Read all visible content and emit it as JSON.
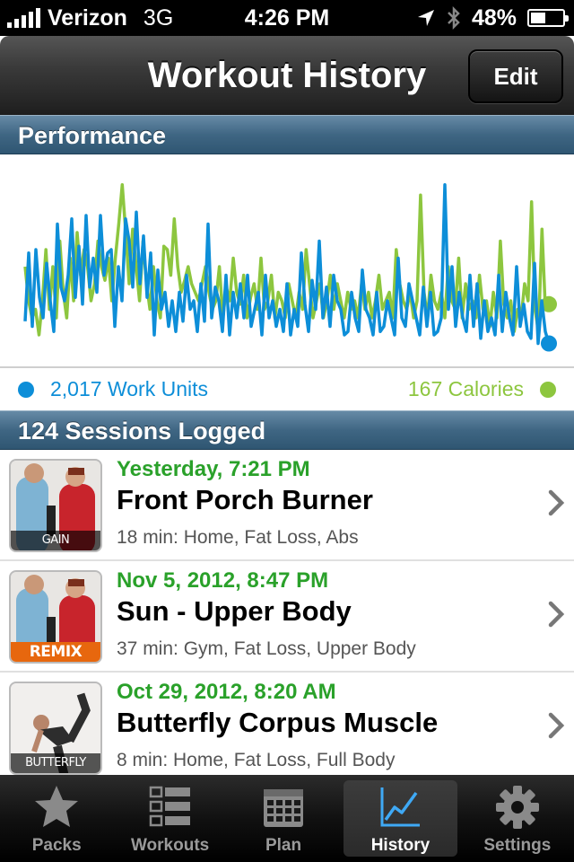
{
  "status_bar": {
    "carrier": "Verizon",
    "network": "3G",
    "time": "4:26 PM",
    "battery": "48%",
    "battery_level": 0.48
  },
  "nav": {
    "title": "Workout History",
    "edit_label": "Edit"
  },
  "performance": {
    "header": "Performance",
    "legend_units": "2,017 Work Units",
    "legend_calories": "167 Calories",
    "colors": {
      "work_units": "#0d8ed8",
      "calories": "#8dc63f"
    }
  },
  "chart_data": {
    "type": "line",
    "series": [
      {
        "name": "Work Units",
        "color": "#0d8ed8",
        "values": [
          0.18,
          0.58,
          0.15,
          0.6,
          0.32,
          0.2,
          0.52,
          0.3,
          0.12,
          0.75,
          0.38,
          0.3,
          0.45,
          0.78,
          0.32,
          0.62,
          0.28,
          0.8,
          0.38,
          0.55,
          0.35,
          0.8,
          0.45,
          0.58,
          0.6,
          0.15,
          0.5,
          0.3,
          0.78,
          0.65,
          0.38,
          0.82,
          0.4,
          0.68,
          0.32,
          0.58,
          0.1,
          0.48,
          0.25,
          0.35,
          0.15,
          0.3,
          0.12,
          0.35,
          0.18,
          0.45,
          0.25,
          0.3,
          0.12,
          0.4,
          0.18,
          0.75,
          0.2,
          0.38,
          0.3,
          0.12,
          0.45,
          0.1,
          0.35,
          0.2,
          0.4,
          0.2,
          0.45,
          0.15,
          0.25,
          0.35,
          0.1,
          0.45,
          0.2,
          0.3,
          0.15,
          0.25,
          0.12,
          0.4,
          0.1,
          0.25,
          0.15,
          0.58,
          0.28,
          0.12,
          0.42,
          0.25,
          0.65,
          0.2,
          0.38,
          0.15,
          0.45,
          0.3,
          0.25,
          0.1,
          0.12,
          0.35,
          0.2,
          0.12,
          0.48,
          0.25,
          0.2,
          0.1,
          0.35,
          0.12,
          0.15,
          0.3,
          0.2,
          0.1,
          0.55,
          0.2,
          0.15,
          0.4,
          0.3,
          0.2,
          0.1,
          0.38,
          0.15,
          0.35,
          0.1,
          0.12,
          0.2,
          0.98,
          0.25,
          0.5,
          0.15,
          0.35,
          0.2,
          0.12,
          0.45,
          0.15,
          0.4,
          0.08,
          0.3,
          0.12,
          0.2,
          0.1,
          0.45,
          0.12,
          0.35,
          0.2,
          0.1,
          0.5,
          0.15,
          0.28,
          0.12,
          0.08,
          0.52,
          0.05,
          0.3,
          0.12,
          0.05
        ],
        "end_value": 0.05
      },
      {
        "name": "Calories",
        "color": "#8dc63f",
        "values": [
          0.5,
          0.3,
          0.2,
          0.25,
          0.1,
          0.3,
          0.6,
          0.25,
          0.5,
          0.2,
          0.65,
          0.35,
          0.2,
          0.55,
          0.3,
          0.7,
          0.45,
          0.6,
          0.5,
          0.3,
          0.4,
          0.65,
          0.5,
          0.42,
          0.55,
          0.3,
          0.55,
          0.75,
          0.98,
          0.7,
          0.4,
          0.72,
          0.5,
          0.3,
          0.65,
          0.4,
          0.25,
          0.5,
          0.3,
          0.2,
          0.62,
          0.6,
          0.45,
          0.78,
          0.5,
          0.35,
          0.42,
          0.5,
          0.4,
          0.35,
          0.3,
          0.4,
          0.5,
          0.35,
          0.25,
          0.3,
          0.5,
          0.2,
          0.38,
          0.3,
          0.55,
          0.35,
          0.28,
          0.45,
          0.2,
          0.32,
          0.4,
          0.25,
          0.55,
          0.25,
          0.3,
          0.45,
          0.2,
          0.35,
          0.3,
          0.2,
          0.4,
          0.3,
          0.2,
          0.35,
          0.25,
          0.6,
          0.4,
          0.2,
          0.3,
          0.4,
          0.2,
          0.3,
          0.45,
          0.25,
          0.4,
          0.3,
          0.2,
          0.35,
          0.25,
          0.3,
          0.2,
          0.4,
          0.25,
          0.35,
          0.2,
          0.3,
          0.45,
          0.25,
          0.3,
          0.35,
          0.2,
          0.6,
          0.4,
          0.3,
          0.25,
          0.35,
          0.2,
          0.3,
          0.92,
          0.35,
          0.2,
          0.45,
          0.3,
          0.25,
          0.35,
          0.2,
          0.5,
          0.3,
          0.25,
          0.55,
          0.2,
          0.4,
          0.25,
          0.3,
          0.2,
          0.45,
          0.25,
          0.3,
          0.15,
          0.35,
          0.2,
          0.65,
          0.28,
          0.2,
          0.3,
          0.12,
          0.25,
          0.2,
          0.4,
          0.3,
          0.88,
          0.25,
          0.12,
          0.72,
          0.25,
          0.28
        ],
        "end_value": 0.28
      }
    ]
  },
  "sessions": {
    "header": "124 Sessions Logged",
    "items": [
      {
        "date": "Yesterday, 7:21 PM",
        "name": "Front Porch Burner",
        "meta": "18 min: Home, Fat Loss, Abs",
        "caption": "GAIN STRENGTH_"
      },
      {
        "date": "Nov 5, 2012, 8:47 PM",
        "name": "Sun - Upper Body",
        "meta": "37 min: Gym, Fat Loss, Upper Body",
        "caption": "REMIX"
      },
      {
        "date": "Oct 29, 2012, 8:20 AM",
        "name": "Butterfly Corpus Muscle",
        "meta": "8 min: Home, Fat Loss, Full Body",
        "caption": "BUTTERFLY YOGA"
      }
    ]
  },
  "tabs": [
    {
      "label": "Packs",
      "icon": "star-icon"
    },
    {
      "label": "Workouts",
      "icon": "list-icon"
    },
    {
      "label": "Plan",
      "icon": "calendar-icon"
    },
    {
      "label": "History",
      "icon": "chart-icon",
      "active": true
    },
    {
      "label": "Settings",
      "icon": "gear-icon"
    }
  ]
}
